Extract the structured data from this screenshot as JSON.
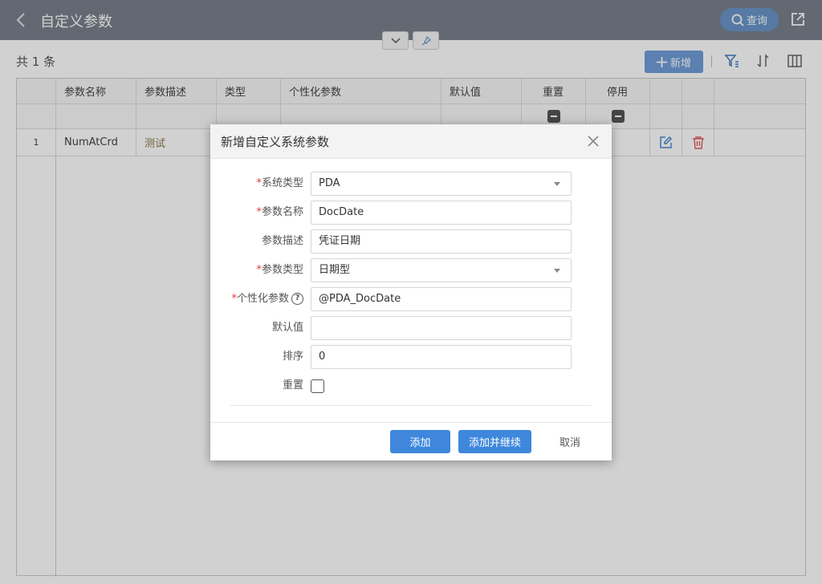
{
  "header": {
    "title": "自定义参数",
    "query_label": "查询"
  },
  "toolbar": {
    "count_text": "共 1 条",
    "add_label": "新增"
  },
  "grid": {
    "columns": [
      "参数名称",
      "参数描述",
      "类型",
      "个性化参数",
      "默认值",
      "重置",
      "停用"
    ],
    "rows": [
      {
        "index": "1",
        "name": "NumAtCrd",
        "desc": "测试"
      }
    ]
  },
  "dialog": {
    "title": "新增自定义系统参数",
    "fields": {
      "system_type": {
        "label": "系统类型",
        "value": "PDA"
      },
      "param_name": {
        "label": "参数名称",
        "value": "DocDate"
      },
      "param_desc": {
        "label": "参数描述",
        "value": "凭证日期"
      },
      "param_type": {
        "label": "参数类型",
        "value": "日期型"
      },
      "custom_param": {
        "label": "个性化参数",
        "value": "@PDA_DocDate",
        "help": "?"
      },
      "default_value": {
        "label": "默认值",
        "value": ""
      },
      "sort": {
        "label": "排序",
        "value": "0"
      },
      "reset": {
        "label": "重置",
        "checked": false
      }
    },
    "required_mark": "*",
    "buttons": {
      "add": "添加",
      "add_continue": "添加并继续",
      "cancel": "取消"
    }
  },
  "colors": {
    "primary": "#3e87dc",
    "header_bg": "#79808b",
    "required": "#e5383b",
    "delete_icon": "#e25b5b"
  }
}
